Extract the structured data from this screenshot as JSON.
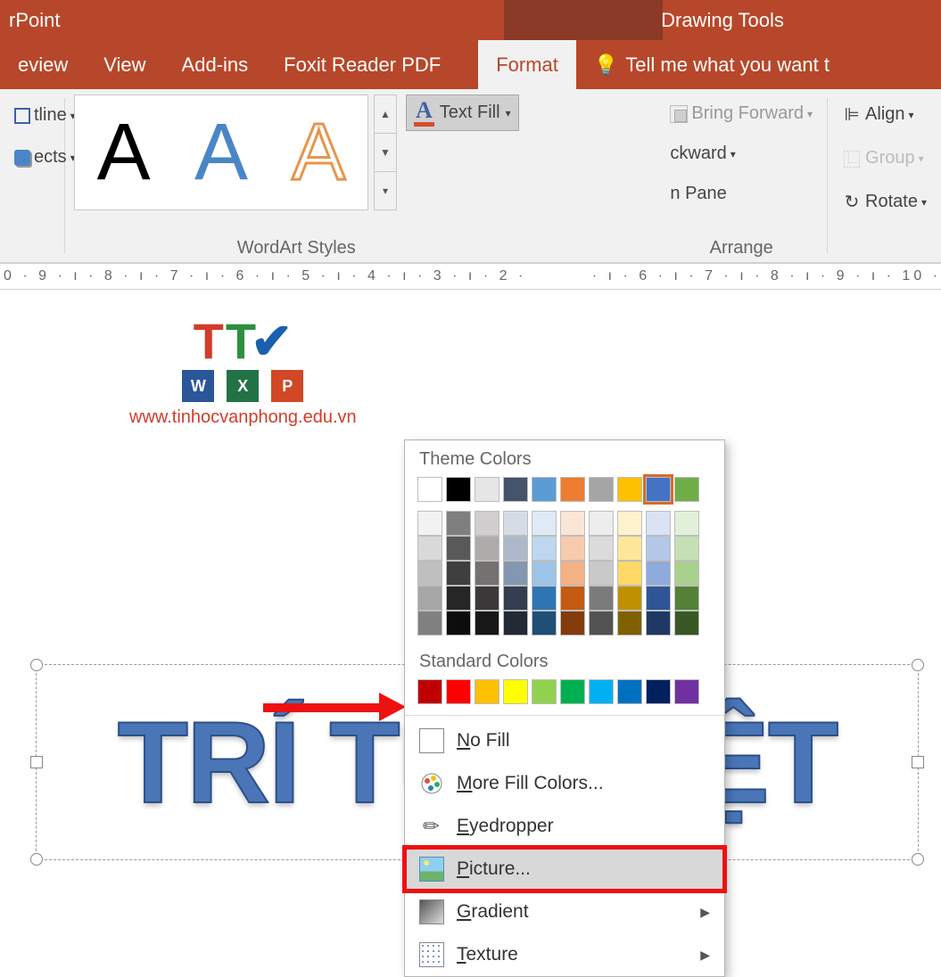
{
  "titlebar": {
    "app": "rPoint",
    "tool": "Drawing Tools"
  },
  "tabs": {
    "review": "eview",
    "view": "View",
    "addins": "Add-ins",
    "foxit": "Foxit Reader PDF",
    "format": "Format",
    "tell": "Tell me what you want t"
  },
  "ribbon": {
    "shape_outline": "tline",
    "shape_effects": "ects",
    "wordart_label": "WordArt Styles",
    "text_fill": "Text Fill",
    "bring_forward": "Bring Forward",
    "send_backward": "ckward",
    "selection_pane": "n Pane",
    "arrange_label": "Arrange",
    "align": "Align",
    "group": "Group",
    "rotate": "Rotate"
  },
  "ruler_left": "0 · 9 · ı · 8 · ı · 7 · ı · 6 · ı · 5 · ı · 4 · ı · 3 · ı · 2 ·",
  "ruler_right": "· ı · 6 · ı · 7 · ı · 8 · ı · 9 · ı · 10 ·",
  "dropdown": {
    "theme": "Theme Colors",
    "standard": "Standard Colors",
    "no_fill": "No Fill",
    "more": "More Fill Colors...",
    "eyedropper": "Eyedropper",
    "picture": "Picture...",
    "gradient": "Gradient",
    "texture": "Texture",
    "theme_row1": [
      "#ffffff",
      "#000000",
      "#e7e6e6",
      "#44546a",
      "#5b9bd5",
      "#ed7d31",
      "#a5a5a5",
      "#ffc000",
      "#4472c4",
      "#70ad47"
    ],
    "theme_shades": [
      [
        "#f2f2f2",
        "#7f7f7f",
        "#d0cece",
        "#d6dce5",
        "#deebf7",
        "#fbe5d6",
        "#ededed",
        "#fff2cc",
        "#dae3f3",
        "#e2f0d9"
      ],
      [
        "#d9d9d9",
        "#595959",
        "#aeabab",
        "#adb9ca",
        "#bdd7ee",
        "#f8cbad",
        "#dbdbdb",
        "#ffe699",
        "#b4c7e7",
        "#c5e0b4"
      ],
      [
        "#bfbfbf",
        "#3f3f3f",
        "#757171",
        "#8497b0",
        "#9dc3e6",
        "#f4b183",
        "#c9c9c9",
        "#ffd966",
        "#8faadc",
        "#a9d18e"
      ],
      [
        "#a6a6a6",
        "#262626",
        "#3a3838",
        "#333f50",
        "#2e75b6",
        "#c55a11",
        "#7b7b7b",
        "#bf9000",
        "#2f5597",
        "#548235"
      ],
      [
        "#808080",
        "#0d0d0d",
        "#171717",
        "#222a35",
        "#1f4e79",
        "#843c0c",
        "#525252",
        "#806000",
        "#203864",
        "#385723"
      ]
    ],
    "standard_row": [
      "#c00000",
      "#ff0000",
      "#ffc000",
      "#ffff00",
      "#92d050",
      "#00b050",
      "#00b0f0",
      "#0070c0",
      "#002060",
      "#7030a0"
    ],
    "selected_theme_index": 8
  },
  "watermark_url": "www.tinhocvanphong.edu.vn",
  "wordart_text": "TRÍ TUỆ VIỆT"
}
